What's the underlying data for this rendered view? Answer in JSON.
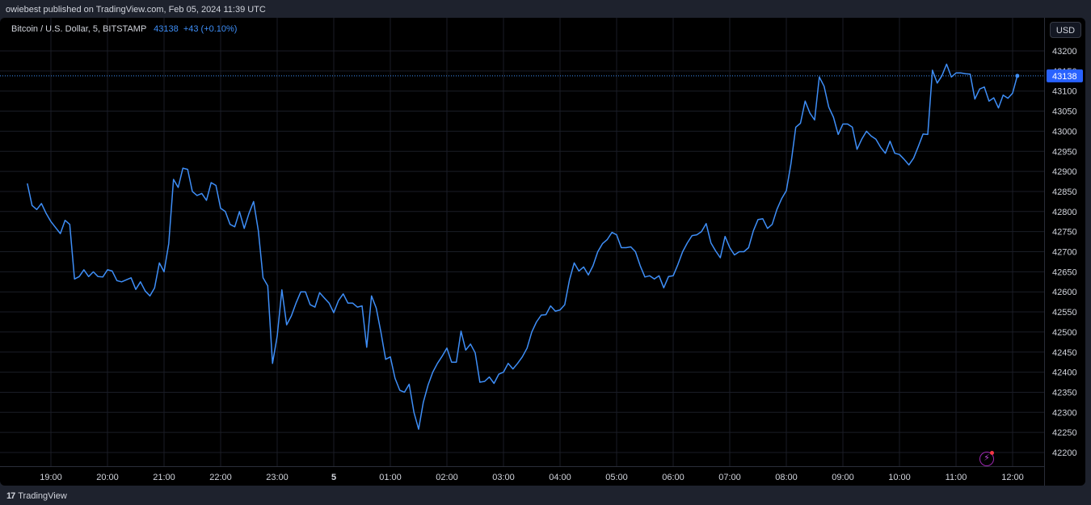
{
  "header": {
    "published_text": "owiebest published on TradingView.com, Feb 05, 2024 11:39 UTC"
  },
  "legend": {
    "symbol": "Bitcoin / U.S. Dollar, 5, BITSTAMP",
    "last_value": "43138",
    "change": "+43 (+0.10%)"
  },
  "currency_button": "USD",
  "footer": {
    "brand": "TradingView",
    "logo_glyph": "17"
  },
  "colors": {
    "line": "#3e8ef7",
    "background": "#000000",
    "grid": "#1a1d26",
    "price_tag": "#2962ff",
    "axis_text": "#d1d4dc"
  },
  "chart_data": {
    "type": "line",
    "series": [
      {
        "values": [
          42870,
          42815,
          42805,
          42820,
          42795,
          42775,
          42760,
          42745,
          42778,
          42768,
          42632,
          42638,
          42655,
          42638,
          42650,
          42638,
          42637,
          42655,
          42652,
          42628,
          42625,
          42630,
          42635,
          42606,
          42625,
          42602,
          42590,
          42610,
          42672,
          42650,
          42720,
          42880,
          42860,
          42908,
          42905,
          42850,
          42840,
          42845,
          42828,
          42872,
          42865,
          42808,
          42800,
          42768,
          42762,
          42800,
          42758,
          42795,
          42825,
          42752,
          42635,
          42615,
          42422,
          42490,
          42605,
          42518,
          42540,
          42572,
          42600,
          42600,
          42568,
          42562,
          42598,
          42585,
          42572,
          42548,
          42578,
          42595,
          42572,
          42572,
          42562,
          42565,
          42462,
          42590,
          42560,
          42500,
          42432,
          42438,
          42385,
          42355,
          42350,
          42370,
          42300,
          42258,
          42325,
          42368,
          42400,
          42422,
          42440,
          42460,
          42425,
          42425,
          42502,
          42455,
          42470,
          42448,
          42375,
          42377,
          42388,
          42372,
          42395,
          42400,
          42422,
          42408,
          42422,
          42438,
          42460,
          42500,
          42525,
          42542,
          42543,
          42565,
          42552,
          42555,
          42568,
          42630,
          42672,
          42652,
          42662,
          42642,
          42665,
          42700,
          42720,
          42730,
          42748,
          42742,
          42710,
          42710,
          42712,
          42700,
          42665,
          42637,
          42640,
          42632,
          42640,
          42610,
          42638,
          42640,
          42668,
          42700,
          42722,
          42740,
          42742,
          42750,
          42770,
          42722,
          42702,
          42685,
          42738,
          42710,
          42692,
          42700,
          42700,
          42710,
          42752,
          42780,
          42782,
          42758,
          42768,
          42805,
          42832,
          42852,
          42920,
          43010,
          43020,
          43075,
          43045,
          43028,
          43135,
          43112,
          43060,
          43035,
          42992,
          43018,
          43018,
          43010,
          42955,
          42980,
          43000,
          42988,
          42980,
          42960,
          42945,
          42975,
          42945,
          42942,
          42930,
          42916,
          42933,
          42962,
          42993,
          42992,
          43152,
          43120,
          43138,
          43167,
          43135,
          43145,
          43145,
          43143,
          43142,
          43080,
          43105,
          43110,
          43075,
          43083,
          43058,
          43090,
          43082,
          43095,
          43138
        ]
      }
    ],
    "x_start": "18:35",
    "x_interval_minutes": 5,
    "x_tick_labels": [
      "19:00",
      "20:00",
      "21:00",
      "22:00",
      "23:00",
      "5",
      "01:00",
      "02:00",
      "03:00",
      "04:00",
      "05:00",
      "06:00",
      "07:00",
      "08:00",
      "09:00",
      "10:00",
      "11:00",
      "12:00"
    ],
    "y_tick_labels": [
      "43200",
      "43150",
      "43100",
      "43050",
      "43000",
      "42950",
      "42900",
      "42850",
      "42800",
      "42750",
      "42700",
      "42650",
      "42600",
      "42550",
      "42500",
      "42450",
      "42400",
      "42350",
      "42300",
      "42250",
      "42200"
    ],
    "ylim": [
      42180,
      43225
    ],
    "last_price": "43138",
    "grid": true,
    "price_line": "dotted"
  }
}
